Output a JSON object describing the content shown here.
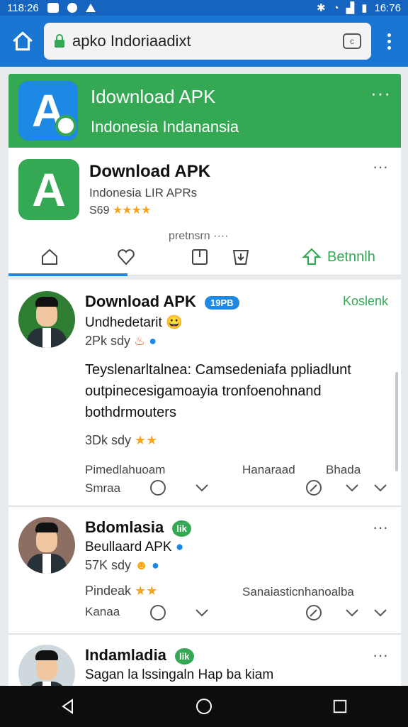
{
  "status_bar": {
    "time_left": "118:26",
    "time_right": "16:76"
  },
  "browser": {
    "url": "apko Indoriaadixt",
    "tab_glyph": "c"
  },
  "hero": {
    "title": "Idownload APK",
    "subtitle": "Indonesia  Indanansia"
  },
  "app": {
    "title": "Download APK",
    "subtitle": "Indonesia  LIR  APRs",
    "rating_count": "S69",
    "stars": "★★★★",
    "caption": "pretnsrn ····",
    "actions": {
      "share_label": "Betnnlh"
    }
  },
  "posts": [
    {
      "title": "Download APK",
      "tag": "19PB",
      "subtitle": "Undhedetarit 😀",
      "meta": "2Pk sdy",
      "follow": "Koslenk",
      "body": "Teyslenarltalnea: Camsedeniafa ppliadlunt outpinecesigamoayia tronfoenohnand bothdrmouters",
      "likes": "3Dk sdy",
      "foot_left_1": "Pimedlahuoam",
      "foot_left_2": "Smraa",
      "foot_mid": "Hanaraad",
      "foot_right": "Bhada"
    },
    {
      "title": "Bdomlasia",
      "tag": "lik",
      "subtitle": "Beullaard APK",
      "meta": "57K sdy",
      "likes": "Pindeak",
      "foot_left_2": "Kanaa",
      "foot_right": "Sanaiasticnhanoalba"
    },
    {
      "title": "Indamladia",
      "tag": "lik",
      "subtitle": "Sagan la lssingaln Hap ba kiam"
    }
  ],
  "colors": {
    "brand_green": "#34a853",
    "browser_blue": "#1976d2",
    "accent_blue": "#1e88e5",
    "star": "#f4a51c"
  }
}
